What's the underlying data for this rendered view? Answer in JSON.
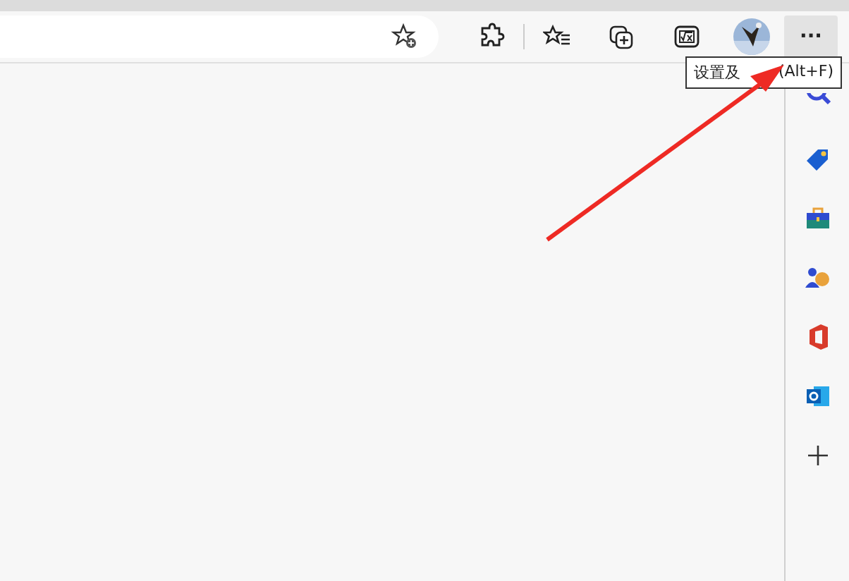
{
  "toolbar": {
    "more_button": {
      "label": "···",
      "selected": true
    }
  },
  "tooltip": {
    "texts": [
      "设置及",
      "(Alt+F)"
    ]
  },
  "sidebar": {
    "items": [
      {
        "kind": "search"
      },
      {
        "kind": "tag"
      },
      {
        "kind": "toolbox"
      },
      {
        "kind": "games"
      },
      {
        "kind": "office"
      },
      {
        "kind": "outlook"
      },
      {
        "kind": "add"
      }
    ]
  }
}
